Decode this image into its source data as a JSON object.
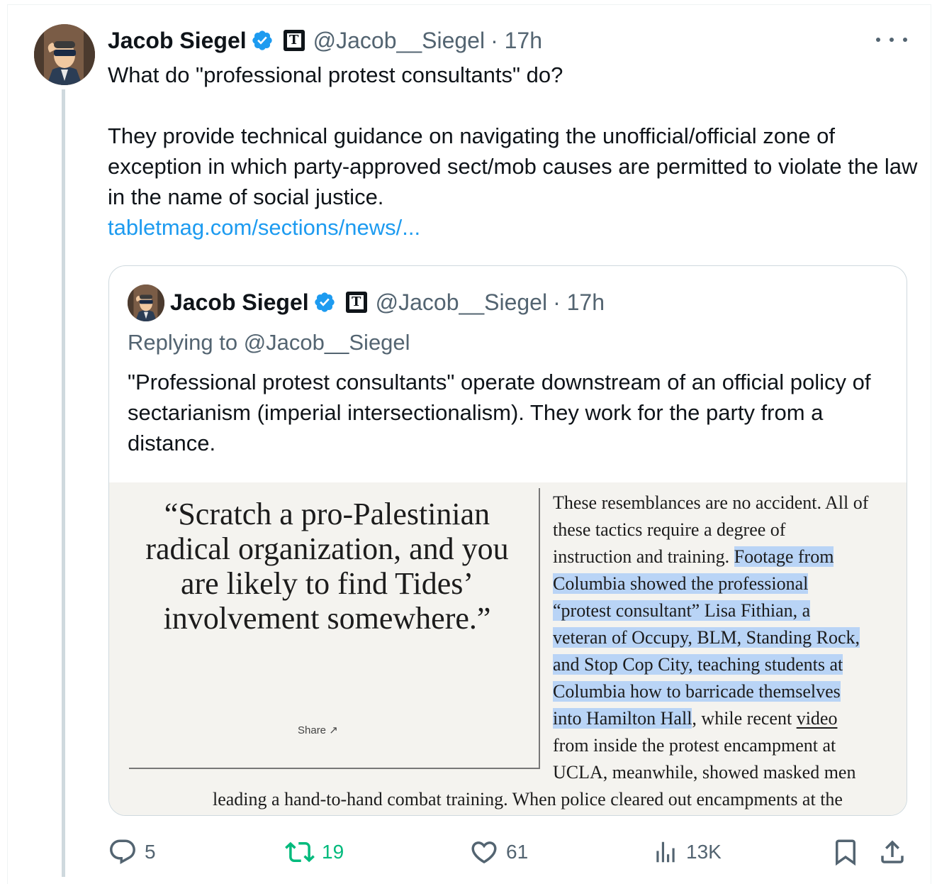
{
  "tweet": {
    "author_name": "Jacob Siegel",
    "badge_letter": "T",
    "handle": "@Jacob__Siegel",
    "time": "· 17h",
    "text": "What do \"professional protest consultants\" do?\n\nThey provide technical guidance on navigating the unofficial/official zone of exception in which party-approved sect/mob causes are permitted to violate the law in the name of social justice.\n",
    "link": "tabletmag.com/sections/news/..."
  },
  "quote": {
    "author_name": "Jacob Siegel",
    "badge_letter": "T",
    "handle": "@Jacob__Siegel",
    "time": "· 17h",
    "replying_to": "Replying to @Jacob__Siegel",
    "text": "\"Professional protest consultants\" operate downstream of an official policy of sectarianism (imperial intersectionalism). They work for the party from a distance.",
    "image": {
      "pull_quote": "“Scratch a pro-Palestinian radical organization, and you are likely to find Tides’ involvement somewhere.”",
      "share_label": "Share ↗",
      "article_lines": {
        "l1": "These resemblances are no accident. All of",
        "l2": "these tactics require a degree of",
        "l3a": "instruction and training. ",
        "l3b": "Footage from",
        "l4": "Columbia showed the professional",
        "l5": "“protest consultant” Lisa Fithian, a",
        "l6": "veteran of Occupy, BLM, Standing Rock,",
        "l7": "and Stop Cop City, teaching students at",
        "l8": "Columbia how to barricade themselves",
        "l9a": "into Hamilton Hall",
        "l9b": ", while recent ",
        "l9c": "video",
        "l10": "from inside the protest encampment at",
        "l11": "UCLA, meanwhile, showed masked men"
      },
      "last_line": "leading a hand-to-hand combat training. When police cleared out encampments at the"
    }
  },
  "actions": {
    "replies": "5",
    "reposts": "19",
    "likes": "61",
    "views": "13K"
  },
  "colors": {
    "link": "#1d9bf0",
    "repost_active": "#00ba7c",
    "verified": "#1d9bf0",
    "secondary_text": "#536471",
    "highlight": "#b9d4f6"
  }
}
